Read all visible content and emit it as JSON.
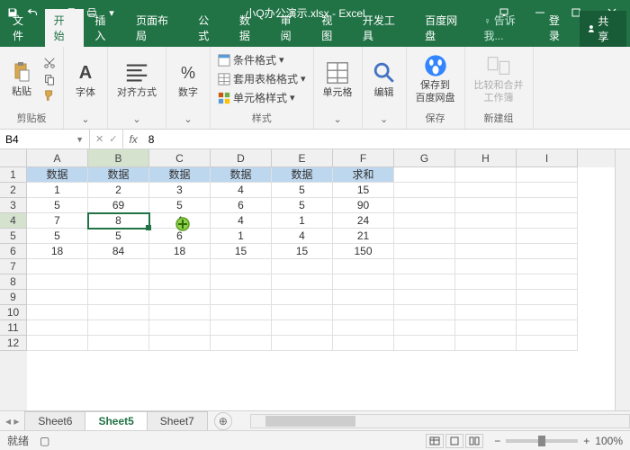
{
  "titlebar": {
    "filename": "小Q办公演示.xlsx - Excel"
  },
  "ribbon_tabs": {
    "file": "文件",
    "home": "开始",
    "insert": "插入",
    "layout": "页面布局",
    "formulas": "公式",
    "data": "数据",
    "review": "审阅",
    "view": "视图",
    "dev": "开发工具",
    "baidu": "百度网盘",
    "tellme": "告诉我...",
    "signin": "登录",
    "share": "共享"
  },
  "ribbon": {
    "clipboard": {
      "paste": "粘贴",
      "label": "剪贴板"
    },
    "font": {
      "label": "字体"
    },
    "align": {
      "label": "对齐方式"
    },
    "number": {
      "label": "数字"
    },
    "styles": {
      "cond": "条件格式",
      "table": "套用表格格式",
      "cell": "单元格样式",
      "label": "样式"
    },
    "cells": {
      "label": "单元格"
    },
    "editing": {
      "label": "编辑"
    },
    "save": {
      "btn": "保存到\n百度网盘",
      "label": "保存"
    },
    "newgroup": {
      "btn": "比较和合并\n工作簿",
      "label": "新建组"
    }
  },
  "namebox": {
    "ref": "B4"
  },
  "formula": {
    "value": "8"
  },
  "columns": [
    "A",
    "B",
    "C",
    "D",
    "E",
    "F",
    "G",
    "H",
    "I"
  ],
  "rows": [
    "1",
    "2",
    "3",
    "4",
    "5",
    "6",
    "7",
    "8",
    "9",
    "10",
    "11",
    "12"
  ],
  "headers": [
    "数据",
    "数据",
    "数据",
    "数据",
    "数据",
    "求和"
  ],
  "data": [
    [
      "1",
      "2",
      "3",
      "4",
      "5",
      "15"
    ],
    [
      "5",
      "69",
      "5",
      "6",
      "5",
      "90"
    ],
    [
      "7",
      "8",
      "4",
      "4",
      "1",
      "24"
    ],
    [
      "5",
      "5",
      "6",
      "1",
      "4",
      "21"
    ],
    [
      "18",
      "84",
      "18",
      "15",
      "15",
      "150"
    ]
  ],
  "active": {
    "row": 3,
    "col": 1
  },
  "sheets": {
    "s1": "Sheet6",
    "s2": "Sheet5",
    "s3": "Sheet7"
  },
  "status": {
    "ready": "就绪",
    "zoom": "100%"
  }
}
